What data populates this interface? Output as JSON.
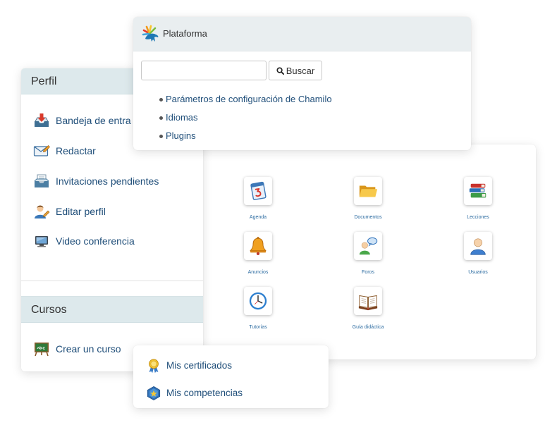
{
  "platform": {
    "title": "Plataforma",
    "logo_icon": "chamilo-logo",
    "search": {
      "value": ""
    },
    "search_button": "Buscar",
    "search_button_icon": "search-icon",
    "links": [
      {
        "label": "Parámetros de configuración de Chamilo"
      },
      {
        "label": "Idiomas"
      },
      {
        "label": "Plugins"
      }
    ]
  },
  "profile": {
    "title": "Perfil",
    "items": [
      {
        "label": "Bandeja de entra",
        "icon": "inbox-icon"
      },
      {
        "label": "Redactar",
        "icon": "compose-icon"
      },
      {
        "label": "Invitaciones pendientes",
        "icon": "invitations-icon"
      },
      {
        "label": "Editar perfil",
        "icon": "edit-profile-icon"
      },
      {
        "label": "Video conferencia",
        "icon": "video-conference-icon"
      }
    ]
  },
  "courses": {
    "title": "Cursos",
    "items": [
      {
        "label": "Crear un curso",
        "icon": "chalkboard-icon"
      }
    ]
  },
  "course_tools": [
    {
      "label": "Agenda",
      "icon": "calendar-icon"
    },
    {
      "label": "Documentos",
      "icon": "folder-icon"
    },
    {
      "label": "Lecciones",
      "icon": "books-icon"
    },
    {
      "label": "Anuncios",
      "icon": "bell-icon"
    },
    {
      "label": "Foros",
      "icon": "forum-icon"
    },
    {
      "label": "Usuarios",
      "icon": "user-icon"
    },
    {
      "label": "Tutorías",
      "icon": "clock-icon"
    },
    {
      "label": "Guía didáctica",
      "icon": "open-book-icon"
    }
  ],
  "achievements": {
    "items": [
      {
        "label": "Mis certificados",
        "icon": "certificate-icon"
      },
      {
        "label": "Mis competencias",
        "icon": "competences-icon"
      }
    ]
  },
  "colors": {
    "link": "#1f4e79",
    "section_header_bg": "#dde9ec",
    "platform_header_bg": "#e9eef0",
    "tool_label": "#2a6aa0"
  }
}
